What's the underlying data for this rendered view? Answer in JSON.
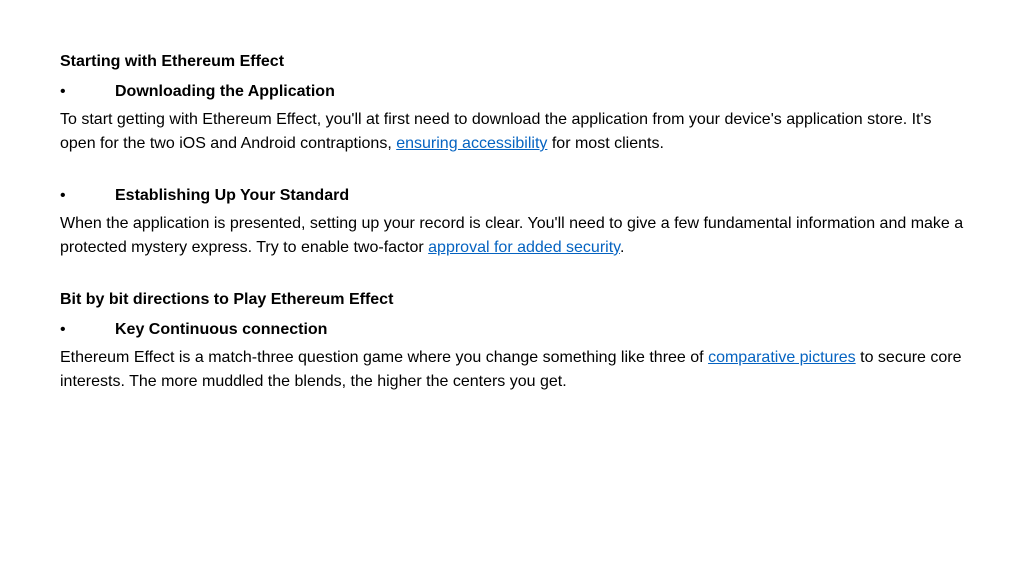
{
  "section1": {
    "heading": "Starting with Ethereum Effect",
    "bullet1": {
      "label": "Downloading the Application",
      "text_before": "To start getting with Ethereum Effect, you'll at first need to download the application from your device's application store. It's open for the two iOS and Android contraptions, ",
      "link": "ensuring accessibility",
      "text_after": " for most clients."
    },
    "bullet2": {
      "label": "Establishing Up Your Standard",
      "text_before": "When the application is presented, setting up your record is clear. You'll need to give a few fundamental information and make a protected mystery express. Try to enable two-factor ",
      "link": "approval for added security",
      "text_after": "."
    }
  },
  "section2": {
    "heading": "Bit by bit directions to Play Ethereum Effect",
    "bullet1": {
      "label": "Key Continuous connection",
      "text_before": "Ethereum Effect is a match-three question game where you change something like three of ",
      "link": "comparative pictures",
      "text_after": " to secure core interests. The more muddled the blends, the higher the centers you get."
    }
  }
}
